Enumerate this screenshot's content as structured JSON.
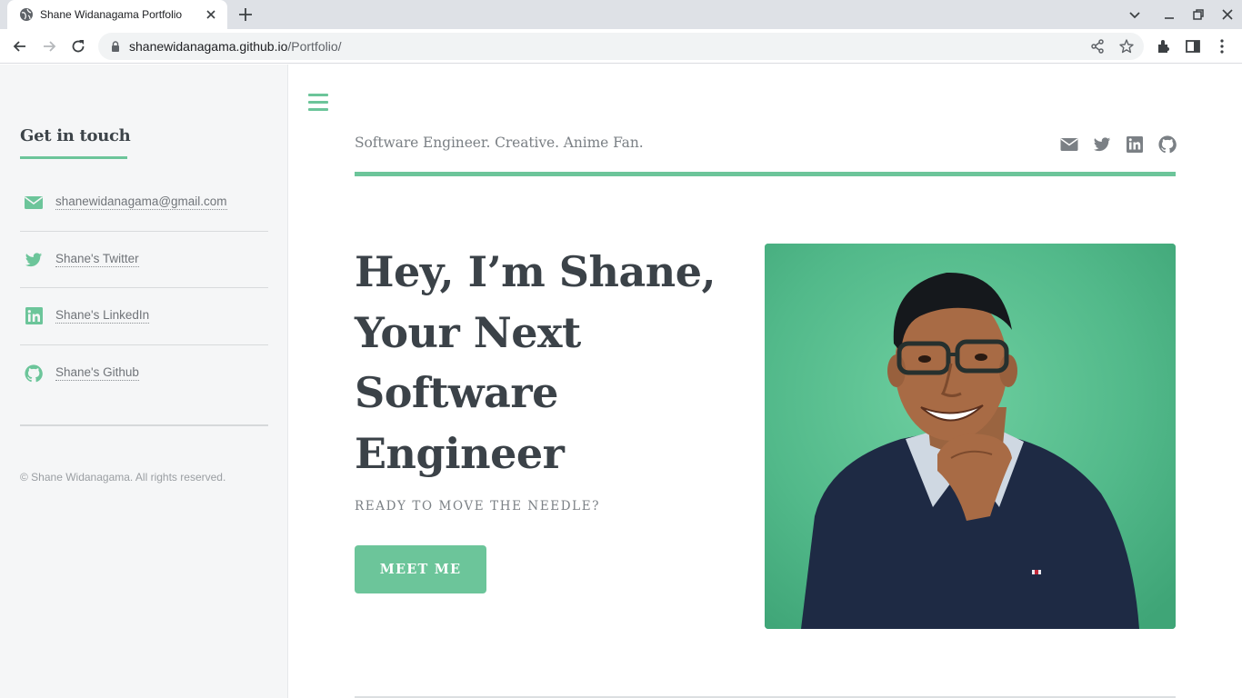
{
  "browser": {
    "tab_title": "Shane Widanagama Portfolio",
    "url_host": "shanewidanagama.github.io",
    "url_path": "/Portfolio/"
  },
  "sidebar": {
    "heading": "Get in touch",
    "contacts": [
      {
        "icon": "envelope-icon",
        "label": "shanewidanagama@gmail.com"
      },
      {
        "icon": "twitter-icon",
        "label": "Shane's Twitter"
      },
      {
        "icon": "linkedin-icon",
        "label": "Shane's LinkedIn"
      },
      {
        "icon": "github-icon",
        "label": "Shane's Github"
      }
    ],
    "copyright": "© Shane Widanagama. All rights reserved."
  },
  "header": {
    "tagline": "Software Engineer. Creative. Anime Fan.",
    "social_icons": [
      "envelope-icon",
      "twitter-icon",
      "linkedin-icon",
      "github-icon"
    ]
  },
  "hero": {
    "title_lines": [
      "Hey, I’m Shane,",
      "Your Next",
      "Software",
      "Engineer"
    ],
    "subtitle": "READY TO MOVE THE NEEDLE?",
    "cta_label": "MEET ME",
    "portrait_alt": "portrait-photo"
  },
  "colors": {
    "accent": "#6cc59a",
    "heading": "#3b4248",
    "muted": "#7b8085",
    "sidebar_bg": "#f5f6f7",
    "photo_bg": "#4fb88a"
  }
}
